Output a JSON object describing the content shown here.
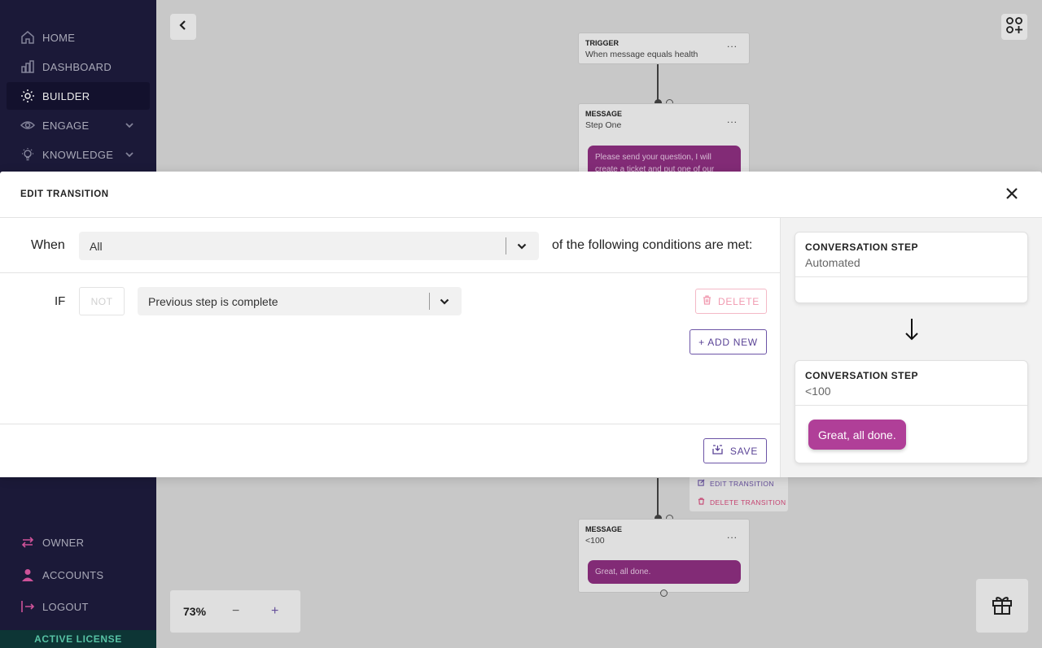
{
  "sidebar": {
    "items": [
      {
        "label": "HOME",
        "icon": "home-icon"
      },
      {
        "label": "DASHBOARD",
        "icon": "dashboard-icon"
      },
      {
        "label": "BUILDER",
        "icon": "builder-icon",
        "active": true
      },
      {
        "label": "ENGAGE",
        "icon": "eye-icon",
        "has_submenu": true
      },
      {
        "label": "KNOWLEDGE",
        "icon": "lightbulb-icon",
        "has_submenu": true
      }
    ],
    "bottom_items": [
      {
        "label": "OWNER",
        "icon": "swap-icon"
      },
      {
        "label": "ACCOUNTS",
        "icon": "user-icon"
      },
      {
        "label": "LOGOUT",
        "icon": "logout-icon"
      }
    ],
    "license_label": "ACTIVE LICENSE"
  },
  "canvas": {
    "trigger_node": {
      "label": "TRIGGER",
      "subtitle": "When message equals health",
      "menu": "..."
    },
    "message_node_1": {
      "label": "MESSAGE",
      "subtitle": "Step One",
      "menu": "...",
      "bubble": "Please send your question, I will create a ticket and put one of our"
    },
    "context_menu": {
      "edit_label": "EDIT TRANSITION",
      "delete_label": "DELETE TRANSITION"
    },
    "message_node_2": {
      "label": "MESSAGE",
      "subtitle": "<100",
      "menu": "...",
      "bubble": "Great, all done."
    },
    "zoom": {
      "value": "73%",
      "minus": "−",
      "plus": "+"
    }
  },
  "modal": {
    "title": "EDIT TRANSITION",
    "when_label": "When",
    "match_select": {
      "value": "All"
    },
    "conditions_text": "of the following conditions are met:",
    "condition": {
      "if_label": "IF",
      "not_label": "NOT",
      "select_value": "Previous step is complete",
      "delete_label": "DELETE"
    },
    "add_new_label": "+ ADD NEW",
    "save_label": "SAVE",
    "preview": {
      "from_step": {
        "label": "CONVERSATION STEP",
        "subtitle": "Automated"
      },
      "to_step": {
        "label": "CONVERSATION STEP",
        "subtitle": "<100",
        "bubble": "Great, all done."
      }
    }
  },
  "colors": {
    "sidebar_bg": "#1e1c3d",
    "accent_purple": "#6c54a6",
    "message_bubble": "#b03f98",
    "delete_pink": "#f19ab0",
    "license_bg": "#0f3a3a",
    "license_text": "#5fd3b3"
  }
}
